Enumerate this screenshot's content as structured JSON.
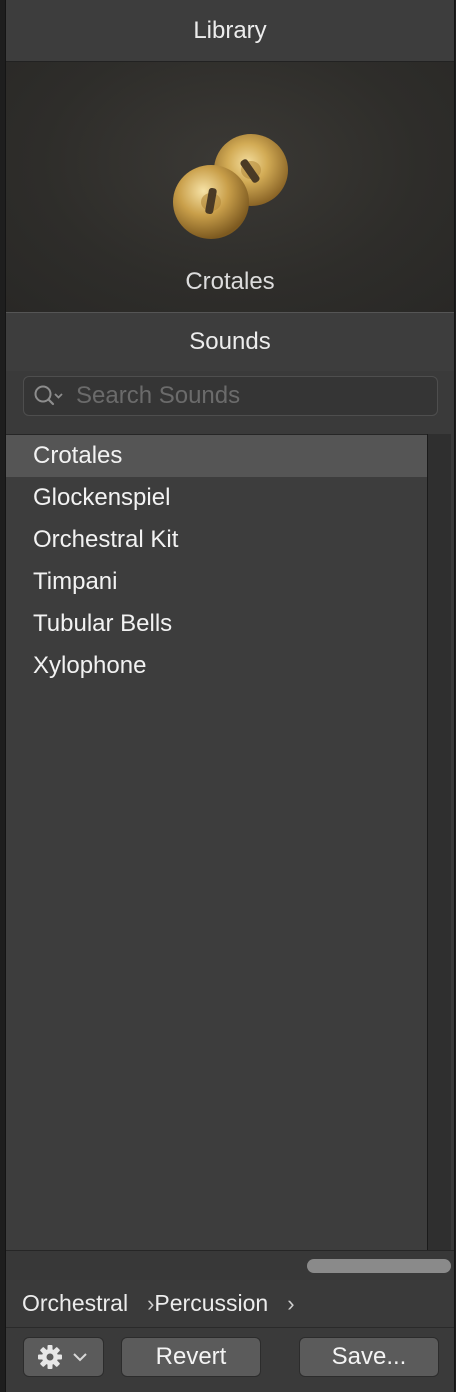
{
  "library": {
    "title": "Library",
    "preview_name": "Crotales"
  },
  "sounds": {
    "title": "Sounds",
    "search_placeholder": "Search Sounds",
    "items": [
      {
        "label": "Crotales",
        "selected": true
      },
      {
        "label": "Glockenspiel",
        "selected": false
      },
      {
        "label": "Orchestral Kit",
        "selected": false
      },
      {
        "label": "Timpani",
        "selected": false
      },
      {
        "label": "Tubular Bells",
        "selected": false
      },
      {
        "label": "Xylophone",
        "selected": false
      }
    ]
  },
  "breadcrumb": {
    "items": [
      "Orchestral",
      "Percussion"
    ],
    "separator": "›"
  },
  "footer": {
    "gear_icon": "gear-icon",
    "revert_label": "Revert",
    "save_label": "Save..."
  },
  "colors": {
    "panel_bg": "#3a3a3a",
    "selected_row": "#555555",
    "cymbal_gold": "#c9a14a"
  }
}
